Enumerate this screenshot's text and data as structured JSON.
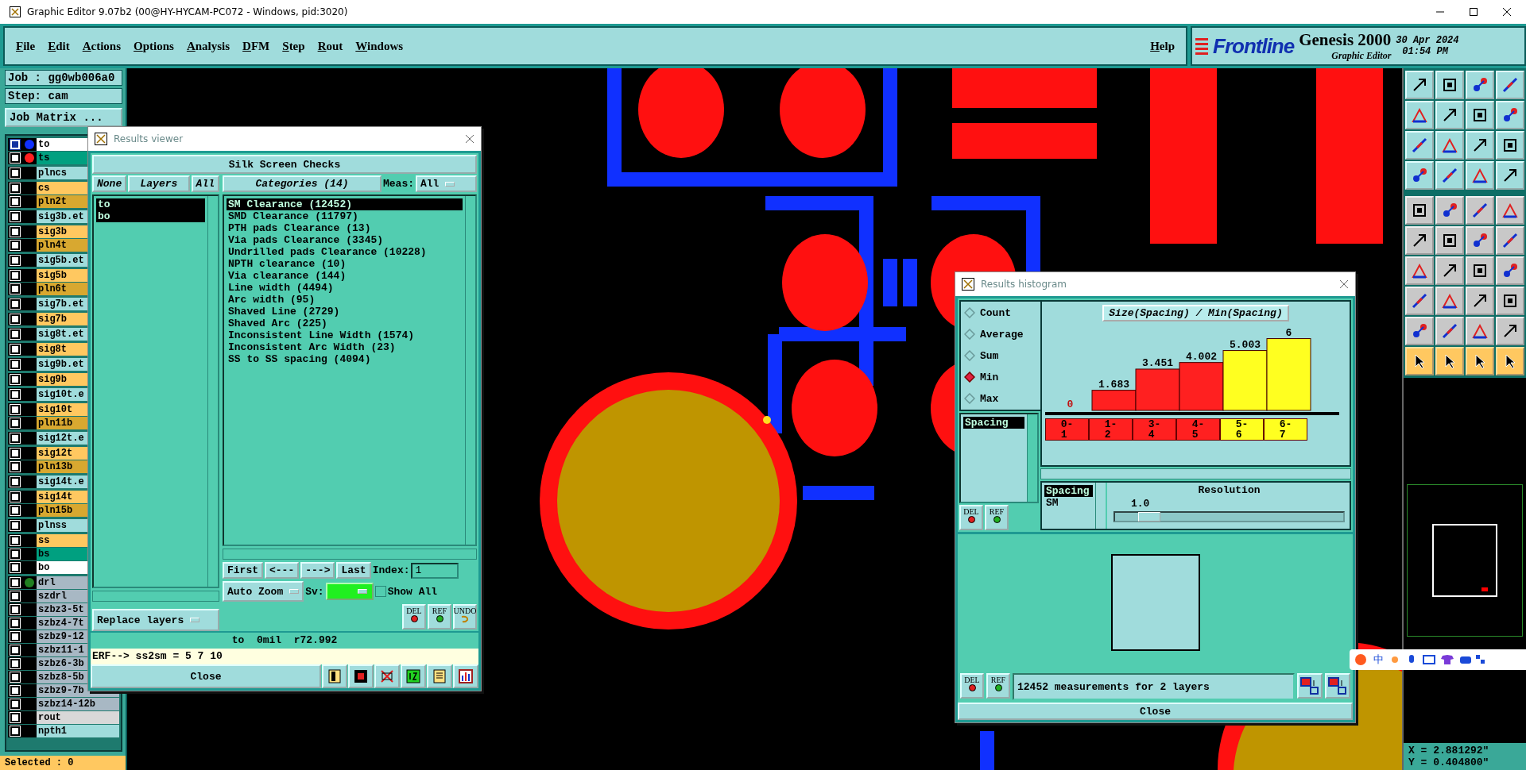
{
  "window": {
    "title": "Graphic Editor 9.07b2 (00@HY-HYCAM-PC072 - Windows, pid:3020)"
  },
  "menu": [
    "File",
    "Edit",
    "Actions",
    "Options",
    "Analysis",
    "DFM",
    "Step",
    "Rout",
    "Windows"
  ],
  "help": "Help",
  "brand": {
    "logo": "Frontline",
    "product": "Genesis 2000",
    "subtitle": "Graphic Editor",
    "date": "30 Apr 2024",
    "time": "01:54 PM"
  },
  "job": {
    "job": "Job : gg0wb006a0",
    "step": "Step: cam",
    "matrix_button": "Job Matrix ..."
  },
  "layer_groups": [
    {
      "layers": [
        {
          "name": "to",
          "color": "#ffffff",
          "dot": {
            "color": "#1030ff"
          },
          "selected": true
        },
        {
          "name": "ts",
          "color": "#00a080",
          "dot": {
            "color": "#ff2020"
          },
          "selected": false
        }
      ]
    },
    {
      "layers": [
        {
          "name": "plncs",
          "color": "#a0dcdc",
          "selected": false
        }
      ]
    },
    {
      "layers": [
        {
          "name": "cs",
          "color": "#ffc860",
          "selected": false
        },
        {
          "name": "pln2t",
          "color": "#d8a830",
          "selected": false
        }
      ]
    },
    {
      "layers": [
        {
          "name": "sig3b.et",
          "color": "#a0dcdc",
          "selected": false
        }
      ]
    },
    {
      "layers": [
        {
          "name": "sig3b",
          "color": "#ffc860",
          "selected": false
        },
        {
          "name": "pln4t",
          "color": "#d8a830",
          "selected": false
        }
      ]
    },
    {
      "layers": [
        {
          "name": "sig5b.et",
          "color": "#a0dcdc",
          "selected": false
        }
      ]
    },
    {
      "layers": [
        {
          "name": "sig5b",
          "color": "#ffc860",
          "selected": false
        },
        {
          "name": "pln6t",
          "color": "#d8a830",
          "selected": false
        }
      ]
    },
    {
      "layers": [
        {
          "name": "sig7b.et",
          "color": "#a0dcdc",
          "selected": false
        }
      ]
    },
    {
      "layers": [
        {
          "name": "sig7b",
          "color": "#ffc860",
          "selected": false
        }
      ]
    },
    {
      "layers": [
        {
          "name": "sig8t.et",
          "color": "#a0dcdc",
          "selected": false
        }
      ]
    },
    {
      "layers": [
        {
          "name": "sig8t",
          "color": "#ffc860",
          "selected": false
        }
      ]
    },
    {
      "layers": [
        {
          "name": "sig9b.et",
          "color": "#a0dcdc",
          "selected": false
        }
      ]
    },
    {
      "layers": [
        {
          "name": "sig9b",
          "color": "#ffc860",
          "selected": false
        }
      ]
    },
    {
      "layers": [
        {
          "name": "sig10t.e",
          "color": "#a0dcdc",
          "selected": false
        }
      ]
    },
    {
      "layers": [
        {
          "name": "sig10t",
          "color": "#ffc860",
          "selected": false
        },
        {
          "name": "pln11b",
          "color": "#d8a830",
          "selected": false
        }
      ]
    },
    {
      "layers": [
        {
          "name": "sig12t.e",
          "color": "#a0dcdc",
          "selected": false
        }
      ]
    },
    {
      "layers": [
        {
          "name": "sig12t",
          "color": "#ffc860",
          "selected": false
        },
        {
          "name": "pln13b",
          "color": "#d8a830",
          "selected": false
        }
      ]
    },
    {
      "layers": [
        {
          "name": "sig14t.e",
          "color": "#a0dcdc",
          "selected": false
        }
      ]
    },
    {
      "layers": [
        {
          "name": "sig14t",
          "color": "#ffc860",
          "selected": false
        },
        {
          "name": "pln15b",
          "color": "#d8a830",
          "selected": false
        }
      ]
    },
    {
      "layers": [
        {
          "name": "plnss",
          "color": "#a0dcdc",
          "selected": false
        }
      ]
    },
    {
      "layers": [
        {
          "name": "ss",
          "color": "#ffc860",
          "selected": false
        },
        {
          "name": "bs",
          "color": "#00a080",
          "selected": false
        },
        {
          "name": "bo",
          "color": "#ffffff",
          "selected": false
        }
      ]
    },
    {
      "layers": [
        {
          "name": "drl",
          "color": "#a8b8c4",
          "dot": {
            "color": "#208020"
          },
          "selected": false
        },
        {
          "name": "szdrl",
          "color": "#a8b8c4",
          "selected": false
        },
        {
          "name": "szbz3-5t",
          "color": "#a8b8c4",
          "selected": false
        },
        {
          "name": "szbz4-7t",
          "color": "#a8b8c4",
          "selected": false
        },
        {
          "name": "szbz9-12",
          "color": "#a8b8c4",
          "selected": false
        },
        {
          "name": "szbz11-1",
          "color": "#a8b8c4",
          "selected": false
        },
        {
          "name": "szbz6-3b",
          "color": "#a8b8c4",
          "selected": false
        },
        {
          "name": "szbz8-5b",
          "color": "#a8b8c4",
          "selected": false
        },
        {
          "name": "szbz9-7b",
          "color": "#a8b8c4",
          "selected": false
        },
        {
          "name": "szbz14-12b",
          "color": "#a8b8c4",
          "selected": false
        },
        {
          "name": "rout",
          "color": "#d8d8d8",
          "selected": false
        },
        {
          "name": "npth1",
          "color": "#a0dcdc",
          "selected": false
        }
      ]
    }
  ],
  "selected_count": "Selected : 0",
  "results_viewer": {
    "title": "Results viewer",
    "header": "Silk Screen Checks",
    "layer_buttons": [
      "None",
      "Layers",
      "All"
    ],
    "layers": [
      {
        "name": "to",
        "selected": true
      },
      {
        "name": "bo",
        "selected": true
      }
    ],
    "replace_layers": "Replace layers",
    "categories_button": "Categories (14)",
    "meas_label": "Meas:",
    "meas_value": "All",
    "categories": [
      {
        "label": "SM Clearance (12452)",
        "selected": true
      },
      {
        "label": "SMD Clearance (11797)",
        "selected": false
      },
      {
        "label": "PTH pads Clearance (13)",
        "selected": false
      },
      {
        "label": "Via pads Clearance (3345)",
        "selected": false
      },
      {
        "label": "Undrilled pads Clearance (10228)",
        "selected": false
      },
      {
        "label": "NPTH clearance (10)",
        "selected": false
      },
      {
        "label": "Via clearance (144)",
        "selected": false
      },
      {
        "label": "Line width (4494)",
        "selected": false
      },
      {
        "label": "Arc width (95)",
        "selected": false
      },
      {
        "label": "Shaved Line (2729)",
        "selected": false
      },
      {
        "label": "Shaved Arc (225)",
        "selected": false
      },
      {
        "label": "Inconsistent Line Width (1574)",
        "selected": false
      },
      {
        "label": "Inconsistent Arc Width (23)",
        "selected": false
      },
      {
        "label": "SS to SS spacing (4094)",
        "selected": false
      }
    ],
    "nav_buttons": [
      "First",
      "<---",
      "--->",
      "Last"
    ],
    "index_label": "Index:",
    "index_value": "1",
    "auto_zoom": "Auto Zoom",
    "sv_label": "Sv:",
    "sv": {
      "color": "#20f020"
    },
    "show_all": {
      "label": "Show All",
      "checked": false
    },
    "edit_buttons": [
      "DEL",
      "REF",
      "UNDO"
    ],
    "status": "to  0mil  r72.992",
    "erf": "ERF--> ss2sm = 5 7 10",
    "close": "Close"
  },
  "histogram": {
    "title": "Results histogram",
    "modes": [
      {
        "label": "Count",
        "selected": false
      },
      {
        "label": "Average",
        "selected": false
      },
      {
        "label": "Sum",
        "selected": false
      },
      {
        "label": "Min",
        "selected": true
      },
      {
        "label": "Max",
        "selected": false
      }
    ],
    "attributes": [
      {
        "label": "Spacing",
        "selected": true
      }
    ],
    "attr_buttons": [
      "DEL",
      "REF"
    ],
    "chart_data": {
      "type": "bar",
      "title": "Size(Spacing) / Min(Spacing)",
      "categories": [
        "0-1",
        "1-2",
        "3-4",
        "4-5",
        "5-6",
        "6-7"
      ],
      "series": [
        {
          "color": "#ff2020",
          "values": [
            0,
            1.683,
            3.451,
            4.002,
            null,
            null
          ]
        },
        {
          "color": "#ffff20",
          "values": [
            null,
            null,
            null,
            null,
            5.003,
            6
          ]
        }
      ],
      "stacked": true,
      "data_labels": true
    },
    "sources": [
      {
        "label": "Spacing",
        "selected": true
      },
      {
        "label": "SM",
        "selected": false
      }
    ],
    "resolution": {
      "label": "Resolution",
      "value": "1.0",
      "level": 0.1
    },
    "status_buttons": [
      "DEL",
      "REF"
    ],
    "status": "12452 measurements for 2 layers",
    "close": "Close"
  },
  "coordinates": {
    "x": "X = 2.881292\"",
    "y": "Y = 0.404800\""
  },
  "ime_bar": {
    "label": "中"
  }
}
